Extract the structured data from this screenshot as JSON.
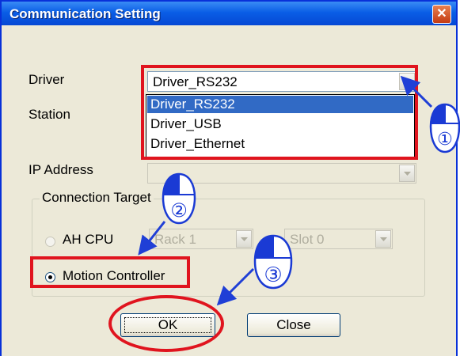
{
  "window": {
    "title": "Communication Setting",
    "close_glyph": "✕"
  },
  "form": {
    "driver_label": "Driver",
    "station_label": "Station",
    "ip_label": "IP Address",
    "driver_value": "Driver_RS232",
    "driver_options": [
      "Driver_RS232",
      "Driver_USB",
      "Driver_Ethernet"
    ],
    "driver_selected_index": 0
  },
  "connection_target": {
    "legend": "Connection Target",
    "ah_cpu_label": "AH CPU",
    "rack_value": "Rack 1",
    "slot_value": "Slot 0",
    "motion_controller_label": "Motion Controller",
    "selected": "Motion Controller"
  },
  "buttons": {
    "ok": "OK",
    "close": "Close"
  },
  "annotations": {
    "step1": "①",
    "step2": "②",
    "step3": "③",
    "highlight_color": "#e0141e",
    "arrow_color": "#1f3fd6",
    "mouse_color": "#1a3ad4"
  }
}
